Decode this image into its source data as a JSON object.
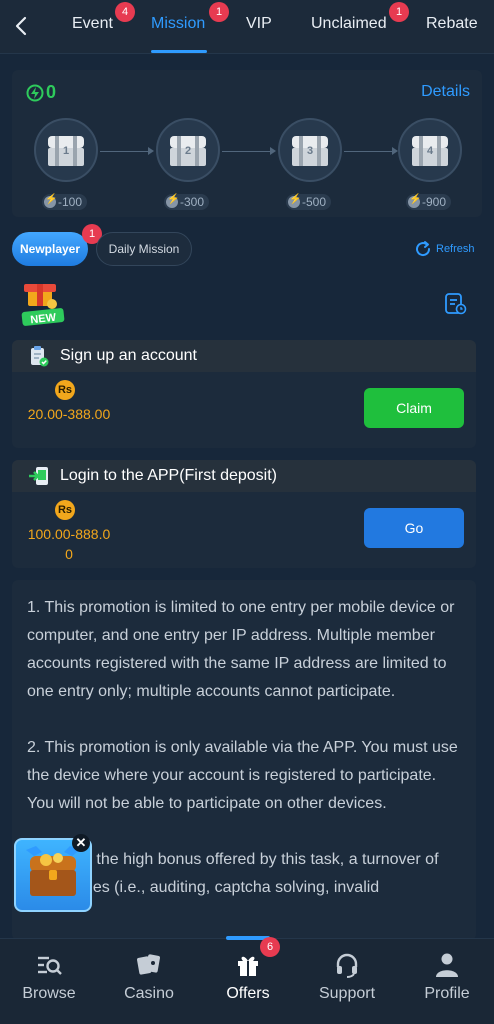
{
  "top_tabs": [
    {
      "label": "Event",
      "badge": "4"
    },
    {
      "label": "Mission",
      "badge": "1"
    },
    {
      "label": "VIP"
    },
    {
      "label": "Unclaimed",
      "badge": "1"
    },
    {
      "label": "Rebate"
    }
  ],
  "progress": {
    "energy": "0",
    "details_label": "Details",
    "chests": [
      {
        "number": "1",
        "cost": "-100"
      },
      {
        "number": "2",
        "cost": "-300"
      },
      {
        "number": "3",
        "cost": "-500"
      },
      {
        "number": "4",
        "cost": "-900"
      }
    ]
  },
  "sub_tabs": {
    "newplayer": "Newplayer",
    "newplayer_badge": "1",
    "daily": "Daily Mission",
    "refresh": "Refresh"
  },
  "new_icon_text": "NEW",
  "tasks": [
    {
      "title": "Sign up an account",
      "currency": "Rs",
      "range": "20.00-388.00",
      "button": "Claim"
    },
    {
      "title": "Login to the APP(First deposit)",
      "currency": "Rs",
      "range": "100.00-888.00",
      "button": "Go"
    }
  ],
  "rules": [
    "1. This promotion is limited to one entry per mobile device or computer, and one entry per IP address. Multiple member accounts registered with the same IP address are limited to one entry only; multiple accounts cannot participate.",
    "2. This promotion is only available via the APP. You must use the device where your account is registered to participate. You will not be able to participate on other devices.",
    "3. Due to the high bonus offered by this task, a turnover of 20.00 times (i.e., auditing, captcha solving, invalid"
  ],
  "bottom_nav": [
    {
      "label": "Browse"
    },
    {
      "label": "Casino"
    },
    {
      "label": "Offers",
      "badge": "6"
    },
    {
      "label": "Support"
    },
    {
      "label": "Profile"
    }
  ],
  "colors": {
    "accent": "#2f9bff",
    "green": "#1fbf3d",
    "gold": "#f2a71c",
    "badge": "#e73b51"
  }
}
